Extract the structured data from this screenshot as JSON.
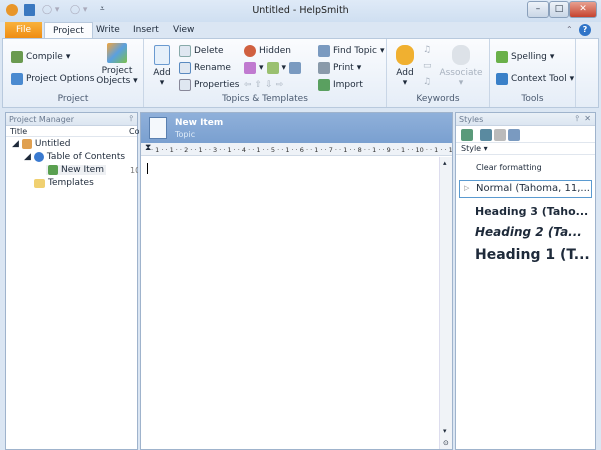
{
  "window": {
    "title": "Untitled - HelpSmith",
    "minimize": "–",
    "maximize": "□",
    "close": "✕"
  },
  "tabs": [
    {
      "label": "File"
    },
    {
      "label": "Project"
    },
    {
      "label": "Write"
    },
    {
      "label": "Insert"
    },
    {
      "label": "View"
    }
  ],
  "ribbon": {
    "project": {
      "compile": "Compile",
      "options": "Project Options",
      "objects_1": "Project",
      "objects_2": "Objects",
      "label": "Project"
    },
    "topics": {
      "add": "Add",
      "delete": "Delete",
      "rename": "Rename",
      "properties": "Properties",
      "hidden": "Hidden",
      "find": "Find Topic",
      "print": "Print",
      "import": "Import",
      "label": "Topics & Templates"
    },
    "keywords": {
      "add": "Add",
      "associate": "Associate",
      "label": "Keywords"
    },
    "tools": {
      "spelling": "Spelling",
      "context": "Context Tool",
      "label": "Tools"
    }
  },
  "project_manager": {
    "title": "Project Manager",
    "col_title": "Title",
    "col_co": "Co",
    "tree": [
      {
        "label": "Untitled"
      },
      {
        "label": "Table of Contents"
      },
      {
        "label": "New Item",
        "id": "10"
      },
      {
        "label": "Templates"
      }
    ]
  },
  "editor": {
    "title": "New Item",
    "subtitle": "Topic",
    "ruler": "· 1 · · 1 · · 2 · · 1 · · 3 · · 1 · · 4 · · 1 · · 5 · · 1 · · 6 · · 1 · · 7 · · 1 · · 8 · · 1 · · 9 · · 1 · · 10 · · 1 · · 11 ·"
  },
  "styles": {
    "title": "Styles",
    "filter": "Style",
    "items": [
      "Clear formatting",
      "Normal (Tahoma, 11,...",
      "Heading 3 (Taho...",
      "Heading 2 (Ta...",
      "Heading 1 (T..."
    ]
  }
}
